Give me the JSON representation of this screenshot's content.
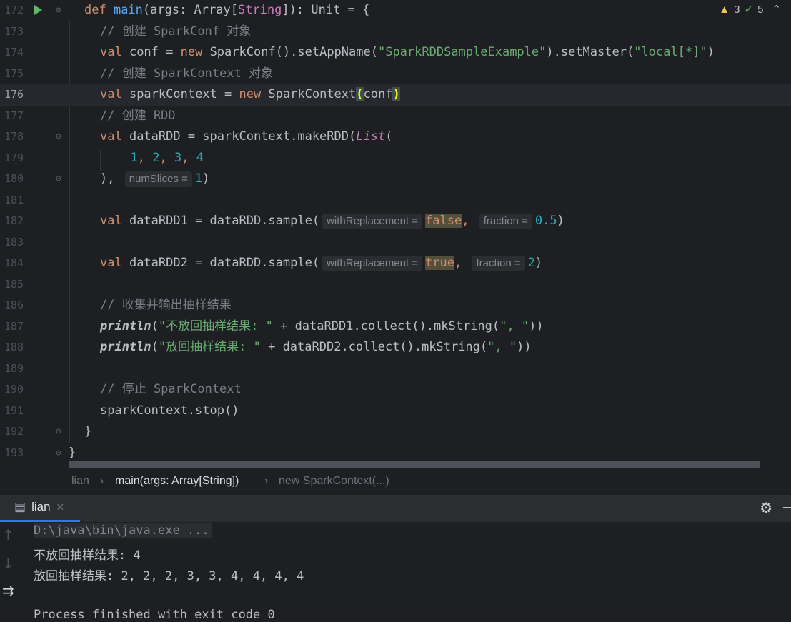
{
  "inspections": {
    "warnings": "3",
    "weak_warnings": "5"
  },
  "code_lines": [
    {
      "num": "172",
      "tokens": [
        [
          "kw",
          "def "
        ],
        [
          "fn",
          "main"
        ],
        [
          "p",
          "(args: Array["
        ],
        [
          "ty",
          "String"
        ],
        [
          "p",
          "]): Unit = {"
        ]
      ]
    },
    {
      "num": "173",
      "tokens": [
        [
          "cm",
          "// 创建 SparkConf 对象"
        ]
      ]
    },
    {
      "num": "174",
      "tokens": [
        [
          "kw",
          "val "
        ],
        [
          "p",
          "conf = "
        ],
        [
          "kw",
          "new "
        ],
        [
          "p",
          "SparkConf().setAppName("
        ],
        [
          "str",
          "\"SparkRDDSampleExample\""
        ],
        [
          "p",
          ").setMaster("
        ],
        [
          "str",
          "\"local[*]\""
        ],
        [
          "p",
          ")"
        ]
      ]
    },
    {
      "num": "175",
      "tokens": [
        [
          "cm",
          "// 创建 SparkContext 对象"
        ]
      ]
    },
    {
      "num": "176",
      "tokens": [
        [
          "kw",
          "val "
        ],
        [
          "p",
          "sparkContext = "
        ],
        [
          "kw",
          "new "
        ],
        [
          "p",
          "SparkContext"
        ],
        [
          "brace",
          "("
        ],
        [
          "p",
          "conf"
        ],
        [
          "brace",
          ")"
        ]
      ]
    },
    {
      "num": "177",
      "tokens": [
        [
          "cm",
          "// 创建 RDD"
        ]
      ]
    },
    {
      "num": "178",
      "tokens": [
        [
          "kw",
          "val "
        ],
        [
          "p",
          "dataRDD = sparkContext.makeRDD("
        ],
        [
          "it",
          "List"
        ],
        [
          "p",
          "("
        ]
      ]
    },
    {
      "num": "179",
      "tokens": [
        [
          "num",
          "  1"
        ],
        [
          "kw",
          ", "
        ],
        [
          "num",
          "2"
        ],
        [
          "kw",
          ", "
        ],
        [
          "num",
          "3"
        ],
        [
          "kw",
          ", "
        ],
        [
          "num",
          "4"
        ]
      ]
    },
    {
      "num": "180",
      "tokens": [
        [
          "p",
          "), "
        ],
        [
          "hint",
          "numSlices ="
        ],
        [
          "num",
          "1"
        ],
        [
          "p",
          ")"
        ]
      ]
    },
    {
      "num": "181",
      "tokens": []
    },
    {
      "num": "182",
      "tokens": [
        [
          "kw",
          "val "
        ],
        [
          "p",
          "dataRDD1 = dataRDD.sample("
        ],
        [
          "hint",
          "withReplacement ="
        ],
        [
          "hlkw",
          "false"
        ],
        [
          "kw",
          ", "
        ],
        [
          "hint",
          "fraction ="
        ],
        [
          "num",
          "0.5"
        ],
        [
          "p",
          ")"
        ]
      ]
    },
    {
      "num": "183",
      "tokens": []
    },
    {
      "num": "184",
      "tokens": [
        [
          "kw",
          "val "
        ],
        [
          "p",
          "dataRDD2 = dataRDD.sample("
        ],
        [
          "hint",
          "withReplacement ="
        ],
        [
          "hlkw",
          "true"
        ],
        [
          "kw",
          ", "
        ],
        [
          "hint",
          "fraction ="
        ],
        [
          "num",
          "2"
        ],
        [
          "p",
          ")"
        ]
      ]
    },
    {
      "num": "185",
      "tokens": []
    },
    {
      "num": "186",
      "tokens": [
        [
          "cm",
          "// 收集并输出抽样结果"
        ]
      ]
    },
    {
      "num": "187",
      "tokens": [
        [
          "itw",
          "println"
        ],
        [
          "p",
          "("
        ],
        [
          "str",
          "\"不放回抽样结果: \""
        ],
        [
          "p",
          " + dataRDD1.collect().mkString("
        ],
        [
          "str",
          "\", \""
        ],
        [
          "p",
          "))"
        ]
      ]
    },
    {
      "num": "188",
      "tokens": [
        [
          "itw",
          "println"
        ],
        [
          "p",
          "("
        ],
        [
          "str",
          "\"放回抽样结果: \""
        ],
        [
          "p",
          " + dataRDD2.collect().mkString("
        ],
        [
          "str",
          "\", \""
        ],
        [
          "p",
          "))"
        ]
      ]
    },
    {
      "num": "189",
      "tokens": []
    },
    {
      "num": "190",
      "tokens": [
        [
          "cm",
          "// 停止 SparkContext"
        ]
      ]
    },
    {
      "num": "191",
      "tokens": [
        [
          "p",
          "sparkContext.stop()"
        ]
      ]
    },
    {
      "num": "192",
      "tokens": [
        [
          "p",
          "}"
        ]
      ]
    },
    {
      "num": "193",
      "tokens": [
        [
          "p",
          "}"
        ]
      ]
    }
  ],
  "breadcrumb": {
    "items": [
      "lian",
      "main(args: Array[String])",
      "new SparkContext(...)"
    ]
  },
  "run_panel": {
    "tab_label": "lian",
    "lines": [
      "D:\\java\\bin\\java.exe ...",
      "不放回抽样结果: 4",
      "放回抽样结果: 2, 2, 2, 3, 3, 4, 4, 4, 4",
      "",
      "Process finished with exit code 0"
    ]
  },
  "icons": [
    "run-gutter-icon",
    "fold-icon",
    "warning-icon",
    "weak-warning-icon",
    "chevron-up-icon",
    "console-icon",
    "close-icon",
    "gear-icon",
    "minimize-icon",
    "arrow-up-icon",
    "arrow-down-icon",
    "soft-wrap-icon"
  ]
}
